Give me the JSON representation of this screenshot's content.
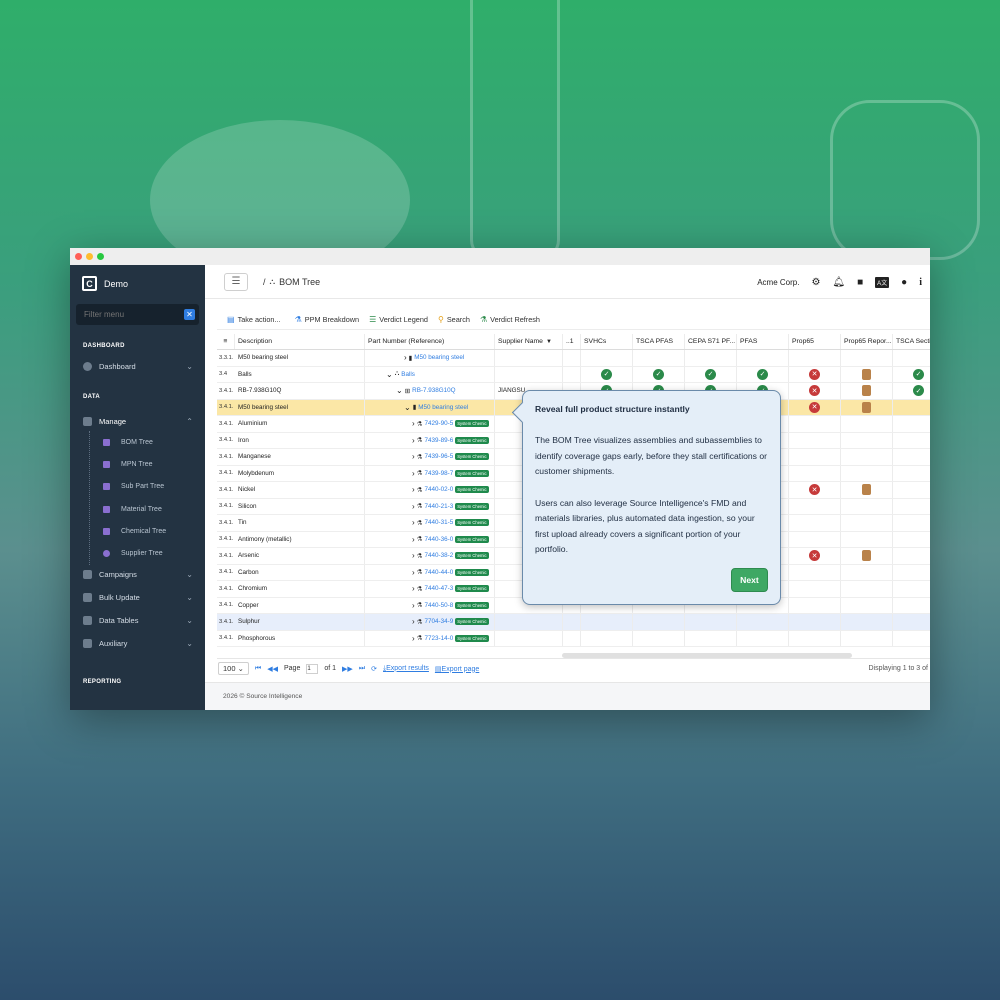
{
  "colors": {
    "accent": "#2f7de1",
    "sidebar_bg": "#233342",
    "highlight_row": "#fbe7a6",
    "ok_green": "#2b8a4a",
    "bad_red": "#c63a3a",
    "next_btn": "#3ea864"
  },
  "sidebar": {
    "brand": "Demo",
    "brand_logo": "C",
    "filter_placeholder": "Filter menu",
    "sections": {
      "dashboard": "DASHBOARD",
      "data": "DATA",
      "reporting": "REPORTING"
    },
    "dashboard_item": "Dashboard",
    "manage": "Manage",
    "sub_items": [
      "BOM Tree",
      "MPN Tree",
      "Sub Part Tree",
      "Material Tree",
      "Chemical Tree",
      "Supplier Tree"
    ],
    "other_items": [
      "Campaigns",
      "Bulk Update",
      "Data Tables",
      "Auxiliary"
    ]
  },
  "header": {
    "crumb_sep": "/",
    "crumb_title": "BOM Tree",
    "company": "Acme Corp.",
    "icons": [
      "gear-icon",
      "bell-icon",
      "folder-icon",
      "translate-icon",
      "user-icon",
      "info-icon"
    ]
  },
  "toolbar": {
    "take_action": "Take action...",
    "ppm": "PPM Breakdown",
    "legend": "Verdict Legend",
    "search": "Search",
    "refresh": "Verdict Refresh"
  },
  "table": {
    "headers": {
      "menu": "≡",
      "description": "Description",
      "part": "Part Number (Reference)",
      "supplier": "Supplier Name",
      "trunc": "..1",
      "svhc": "SVHCs",
      "tsca_pfas": "TSCA PFAS",
      "cepa": "CEPA S71 PF...",
      "pfas": "PFAS",
      "prop65": "Prop65",
      "prop65r": "Prop65 Repor...",
      "tsca_sec": "TSCA Secti..."
    },
    "rows": [
      {
        "num": "3.3.1.",
        "desc": "M50 bearing steel",
        "part": "M50 bearing steel",
        "badge": "",
        "supplier": "",
        "v": [
          "",
          "",
          "",
          "",
          "",
          "",
          ""
        ]
      },
      {
        "num": "3.4",
        "desc": "Balls",
        "part": "Balls",
        "badge": "",
        "supplier": "",
        "v": [
          "ok",
          "ok",
          "ok",
          "ok",
          "bad",
          "doc",
          "ok"
        ]
      },
      {
        "num": "3.4.1.",
        "desc": "RB-7.938G10Q",
        "part": "RB-7.938G10Q",
        "badge": "",
        "supplier": "JIANGSU",
        "v": [
          "ok",
          "ok",
          "ok",
          "ok",
          "bad",
          "doc",
          "ok"
        ]
      },
      {
        "num": "3.4.1.",
        "desc": "M50 bearing steel",
        "part": "M50 bearing steel",
        "badge": "",
        "supplier": "",
        "v": [
          "",
          "",
          "",
          "",
          "bad",
          "doc",
          ""
        ]
      },
      {
        "num": "3.4.1.",
        "desc": "Aluminium",
        "part": "7429-90-5",
        "badge": "System Chemic",
        "supplier": "",
        "v": [
          "",
          "",
          "",
          "",
          "",
          "",
          ""
        ]
      },
      {
        "num": "3.4.1.",
        "desc": "Iron",
        "part": "7439-89-6",
        "badge": "System Chemic",
        "supplier": "",
        "v": [
          "",
          "",
          "",
          "",
          "",
          "",
          ""
        ]
      },
      {
        "num": "3.4.1.",
        "desc": "Manganese",
        "part": "7439-96-5",
        "badge": "System Chemic",
        "supplier": "",
        "v": [
          "",
          "",
          "",
          "",
          "",
          "",
          ""
        ]
      },
      {
        "num": "3.4.1.",
        "desc": "Molybdenum",
        "part": "7439-98-7",
        "badge": "System Chemic",
        "supplier": "",
        "v": [
          "",
          "",
          "",
          "",
          "",
          "",
          ""
        ]
      },
      {
        "num": "3.4.1.",
        "desc": "Nickel",
        "part": "7440-02-0",
        "badge": "System Chemic",
        "supplier": "",
        "v": [
          "",
          "",
          "",
          "",
          "bad",
          "doc",
          ""
        ]
      },
      {
        "num": "3.4.1.",
        "desc": "Silicon",
        "part": "7440-21-3",
        "badge": "System Chemic",
        "supplier": "",
        "v": [
          "",
          "",
          "",
          "",
          "",
          "",
          ""
        ]
      },
      {
        "num": "3.4.1.",
        "desc": "Tin",
        "part": "7440-31-5",
        "badge": "System Chemic",
        "supplier": "",
        "v": [
          "",
          "",
          "",
          "",
          "",
          "",
          ""
        ]
      },
      {
        "num": "3.4.1.",
        "desc": "Antimony (metallic)",
        "part": "7440-36-0",
        "badge": "System Chemic",
        "supplier": "",
        "v": [
          "",
          "",
          "",
          "",
          "",
          "",
          ""
        ]
      },
      {
        "num": "3.4.1.",
        "desc": "Arsenic",
        "part": "7440-38-2",
        "badge": "System Chemic",
        "supplier": "",
        "v": [
          "",
          "",
          "",
          "",
          "bad",
          "doc",
          ""
        ]
      },
      {
        "num": "3.4.1.",
        "desc": "Carbon",
        "part": "7440-44-0",
        "badge": "System Chemic",
        "supplier": "",
        "v": [
          "",
          "",
          "",
          "",
          "",
          "",
          ""
        ]
      },
      {
        "num": "3.4.1.",
        "desc": "Chromium",
        "part": "7440-47-3",
        "badge": "System Chemic",
        "supplier": "",
        "v": [
          "",
          "",
          "",
          "",
          "",
          "",
          ""
        ]
      },
      {
        "num": "3.4.1.",
        "desc": "Copper",
        "part": "7440-50-8",
        "badge": "System Chemic",
        "supplier": "",
        "v": [
          "",
          "",
          "",
          "",
          "",
          "",
          ""
        ]
      },
      {
        "num": "3.4.1.",
        "desc": "Sulphur",
        "part": "7704-34-9",
        "badge": "System Chemic",
        "supplier": "",
        "v": [
          "",
          "",
          "",
          "",
          "",
          "",
          ""
        ]
      },
      {
        "num": "3.4.1.",
        "desc": "Phosphorous",
        "part": "7723-14-0",
        "badge": "System Chemic",
        "supplier": "",
        "v": [
          "",
          "",
          "",
          "",
          "",
          "",
          ""
        ]
      }
    ]
  },
  "pager": {
    "size": "100",
    "page_label": "Page",
    "page_value": "1",
    "of": "of 1",
    "export_results": "Export results",
    "export_page": "Export page",
    "info": "Displaying 1 to 3 of"
  },
  "footer": "2026 © Source Intelligence",
  "popover": {
    "title": "Reveal full product structure instantly",
    "p1": "The BOM Tree visualizes assemblies and subassemblies to identify coverage gaps early, before they stall certifications or customer shipments.",
    "p2": "Users can also leverage Source Intelligence's FMD and materials libraries, plus automated data ingestion, so your first upload already covers a significant portion of your portfolio.",
    "next": "Next"
  }
}
